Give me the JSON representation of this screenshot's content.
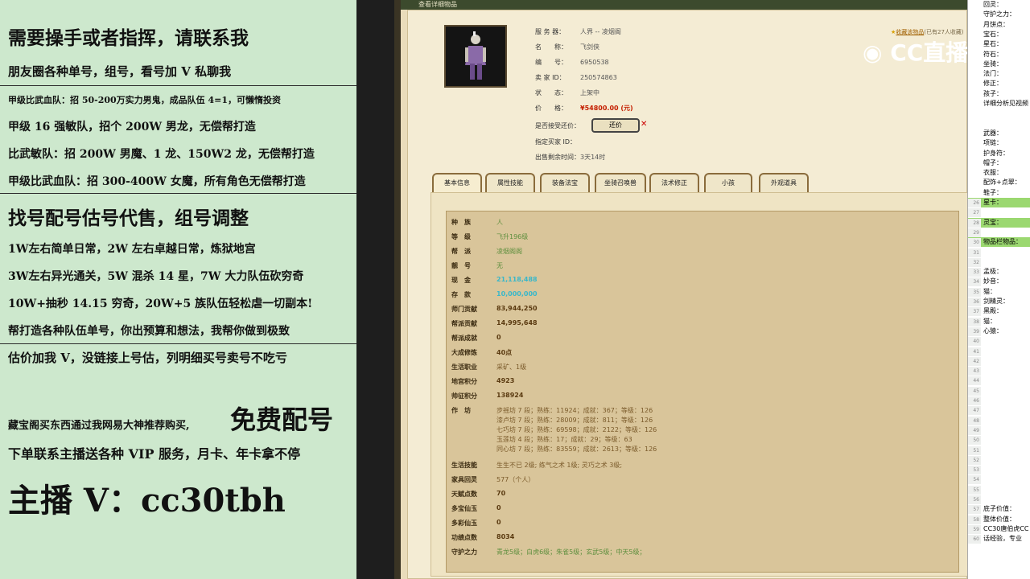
{
  "left": {
    "lines": [
      "需要操手或者指挥，请联系我",
      "朋友圈各种单号，组号，看号加 V 私聊我",
      "甲级比武血队：招 50-200万实力男鬼，成品队伍 4=1，可懒惰投资",
      "甲级 16 强敏队，招个 200W 男龙，无偿帮打造",
      "比武敏队：招 200W 男魔、1 龙、150W2 龙，无偿帮打造",
      "甲级比武血队：招 300-400W 女魔，所有角色无偿帮打造",
      "找号配号估号代售，组号调整",
      "1W左右简单日常，2W 左右卓越日常，炼狱地宫",
      "3W左右异光通关，5W 混杀 14 星，7W 大力队伍砍穷奇",
      "10W+抽秒 14.15 穷奇，20W+5 族队伍轻松虐一切副本!",
      "帮打造各种队伍单号，你出预算和想法，我帮你做到极致",
      "估价加我 V，没链接上号估，列明细买号卖号不吃亏",
      "藏宝阁买东西通过我网易大神推荐购买,",
      "免费配号",
      "下单联系主播送各种 VIP 服务，月卡、年卡拿不停",
      "主播 V：cc30tbh"
    ]
  },
  "window": {
    "title": "查看详细物品"
  },
  "info": [
    {
      "k": "服 务 器：",
      "v": "人界 -- 凌烟阁"
    },
    {
      "k": "名　　称：",
      "v": "飞剑侠"
    },
    {
      "k": "编　　号：",
      "v": "6950538"
    },
    {
      "k": "卖 家 ID：",
      "v": "250574863"
    },
    {
      "k": "状　　态：",
      "v": "上架中"
    },
    {
      "k": "价　　格：",
      "v": "¥54800.00 (元)"
    },
    {
      "k": "是否接受还价：",
      "v": ""
    },
    {
      "k": "指定买家 ID：",
      "v": ""
    },
    {
      "k": "出售剩余时间：",
      "v": "3天14时"
    }
  ],
  "offer_button": "还价",
  "collect": {
    "link": "收藏该物品",
    "text": "(已有27人收藏)"
  },
  "logo_text": "CC直播",
  "tabs": [
    "基本信息",
    "属性技能",
    "装备法宝",
    "坐骑召唤兽",
    "法术修正",
    "小孩",
    "外观道具"
  ],
  "stats": [
    {
      "k": "种　族",
      "v": "人"
    },
    {
      "k": "等　级",
      "v": "飞升196级"
    },
    {
      "k": "帮　派",
      "v": "凌烟阁阁"
    },
    {
      "k": "靓　号",
      "v": "无"
    },
    {
      "k": "现　金",
      "v": "21,118,488"
    },
    {
      "k": "存　款",
      "v": "10,000,000"
    },
    {
      "k": "师门贡献",
      "v": "83,944,250"
    },
    {
      "k": "帮派贡献",
      "v": "14,995,648"
    },
    {
      "k": "帮派成就",
      "v": "0"
    },
    {
      "k": "大成修炼",
      "v": "40点"
    },
    {
      "k": "生活职业",
      "v": "采矿、1级"
    },
    {
      "k": "地宫积分",
      "v": "4923"
    },
    {
      "k": "帅征积分",
      "v": "138924"
    },
    {
      "k": "作　坊",
      "v": "步摇坊 7 段；熟练：11924；成就：367；等级：126|漆卢坊 7 段；熟练：28009；成就：811；等级：126|七巧坊 7 段；熟练：69598；成就：2122；等级：126|玉莲坊 4 段；熟练：17；成就：29；等级：63|同心坊 7 段；熟练：83559；成就：2613；等级：126"
    },
    {
      "k": "生活技能",
      "v": "生生不已 2级; 练气之术 1级; 灵巧之术 3级;"
    },
    {
      "k": "家具回灵",
      "v": "577（个人）"
    },
    {
      "k": "天赋点数",
      "v": "70"
    },
    {
      "k": "多宝仙玉",
      "v": "0"
    },
    {
      "k": "多彩仙玉",
      "v": "0"
    },
    {
      "k": "功绩点数",
      "v": "8034"
    },
    {
      "k": "守护之力",
      "v": "青龙5级；白虎6级；朱雀5级；玄武5级；中天5级；"
    }
  ],
  "right": [
    {
      "n": "",
      "t": "回灵："
    },
    {
      "n": "",
      "t": "守护之力："
    },
    {
      "n": "",
      "t": "月饼点："
    },
    {
      "n": "",
      "t": "宝石："
    },
    {
      "n": "",
      "t": "星石："
    },
    {
      "n": "",
      "t": "符石："
    },
    {
      "n": "",
      "t": "坐骑："
    },
    {
      "n": "",
      "t": "法门："
    },
    {
      "n": "",
      "t": "修正："
    },
    {
      "n": "",
      "t": "孩子："
    },
    {
      "n": "",
      "t": "详细分析见视频"
    },
    {
      "n": "",
      "t": ""
    },
    {
      "n": "",
      "t": ""
    },
    {
      "n": "",
      "t": "武器："
    },
    {
      "n": "",
      "t": "项链："
    },
    {
      "n": "",
      "t": "护身符："
    },
    {
      "n": "",
      "t": "帽子："
    },
    {
      "n": "",
      "t": "衣服："
    },
    {
      "n": "",
      "t": "配饰+点翠："
    },
    {
      "n": "",
      "t": "鞋子："
    },
    {
      "n": "26",
      "t": "星卡："
    },
    {
      "n": "27",
      "t": ""
    },
    {
      "n": "28",
      "t": "灵宝："
    },
    {
      "n": "29",
      "t": ""
    },
    {
      "n": "30",
      "t": "物品栏物品："
    },
    {
      "n": "31",
      "t": ""
    },
    {
      "n": "32",
      "t": ""
    },
    {
      "n": "33",
      "t": "孟极："
    },
    {
      "n": "34",
      "t": "妙音："
    },
    {
      "n": "35",
      "t": "猫："
    },
    {
      "n": "36",
      "t": "剑精灵："
    },
    {
      "n": "37",
      "t": "黑殿："
    },
    {
      "n": "38",
      "t": "猫："
    },
    {
      "n": "39",
      "t": "心猿："
    },
    {
      "n": "40",
      "t": ""
    },
    {
      "n": "41",
      "t": ""
    },
    {
      "n": "42",
      "t": ""
    },
    {
      "n": "43",
      "t": ""
    },
    {
      "n": "44",
      "t": ""
    },
    {
      "n": "45",
      "t": ""
    },
    {
      "n": "46",
      "t": ""
    },
    {
      "n": "47",
      "t": ""
    },
    {
      "n": "48",
      "t": ""
    },
    {
      "n": "49",
      "t": ""
    },
    {
      "n": "50",
      "t": ""
    },
    {
      "n": "51",
      "t": ""
    },
    {
      "n": "52",
      "t": ""
    },
    {
      "n": "53",
      "t": ""
    },
    {
      "n": "54",
      "t": ""
    },
    {
      "n": "55",
      "t": ""
    },
    {
      "n": "56",
      "t": ""
    },
    {
      "n": "57",
      "t": "底子价值："
    },
    {
      "n": "58",
      "t": "整体价值："
    },
    {
      "n": "59",
      "t": "CC30唐伯虎CC"
    },
    {
      "n": "60",
      "t": "话经验，专业"
    }
  ]
}
